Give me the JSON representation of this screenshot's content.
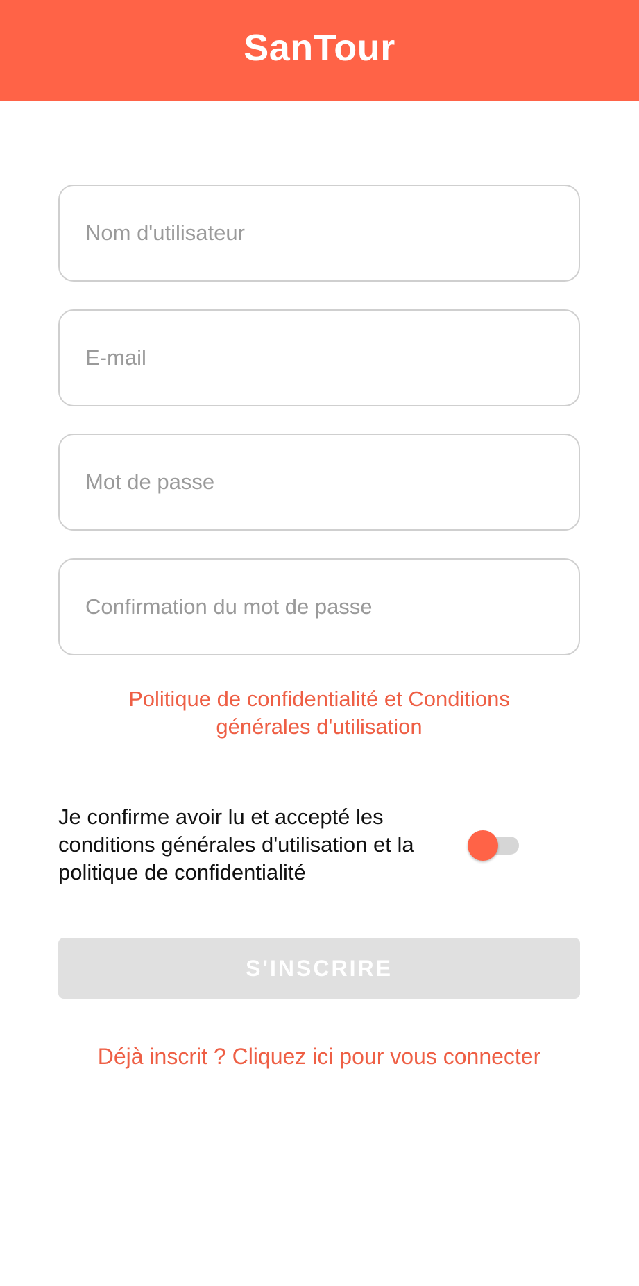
{
  "app_bar": {
    "title": "SanTour",
    "color": "#FF6347"
  },
  "form": {
    "username": {
      "placeholder": "Nom d'utilisateur",
      "value": ""
    },
    "email": {
      "placeholder": "E-mail",
      "value": ""
    },
    "password": {
      "placeholder": "Mot de passe",
      "value": ""
    },
    "password_confirm": {
      "placeholder": "Confirmation du mot de passe",
      "value": ""
    }
  },
  "policy_link": {
    "line1": "Politique de confidentialité et Conditions",
    "line2": "générales d'utilisation"
  },
  "consent": {
    "line1": "Je confirme avoir lu et accepté les",
    "line2": "conditions générales d'utilisation et la",
    "line3": "politique de confidentialité",
    "toggle_state": "off"
  },
  "submit": {
    "label": "S'INSCRIRE",
    "state": "disabled"
  },
  "login_link": {
    "label": "Déjà inscrit ? Cliquez ici pour vous connecter"
  },
  "colors": {
    "accent": "#FF6347",
    "link": "#EE5F45",
    "disabled_button": "#e0e0e0"
  }
}
